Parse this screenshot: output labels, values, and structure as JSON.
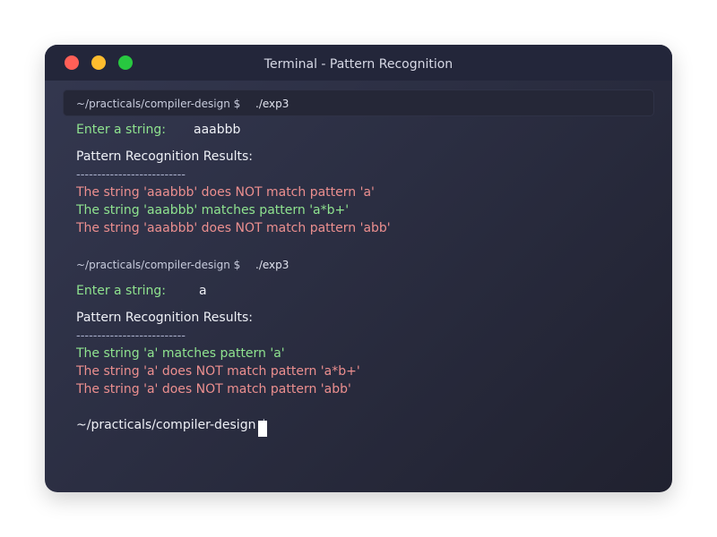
{
  "window": {
    "title": "Terminal - Pattern Recognition"
  },
  "session1": {
    "prompt": "~/practicals/compiler-design $",
    "command": "./exp3",
    "input_label": "Enter a string:",
    "input_value": "aaabbb",
    "results_heading": "Pattern Recognition Results:",
    "separator": "--------------------------",
    "results": [
      "The string 'aaabbb' does NOT match pattern 'a'",
      "The string 'aaabbb' matches pattern 'a*b+'",
      "The string 'aaabbb' does NOT match pattern 'abb'"
    ]
  },
  "session2": {
    "prompt": "~/practicals/compiler-design $",
    "command": "./exp3",
    "input_label": "Enter a string:",
    "input_value": "a",
    "results_heading": "Pattern Recognition Results:",
    "separator": "--------------------------",
    "results": [
      "The string 'a' matches pattern 'a'",
      "The string 'a' does NOT match pattern 'a*b+'",
      "The string 'a' does NOT match pattern 'abb'"
    ]
  },
  "final_prompt": "~/practicals/compiler-design $",
  "colors": {
    "match": "#8fe38f",
    "no_match": "#ec8f8f",
    "close": "#ff5f57",
    "minimize": "#febc2e",
    "maximize": "#28c840"
  }
}
